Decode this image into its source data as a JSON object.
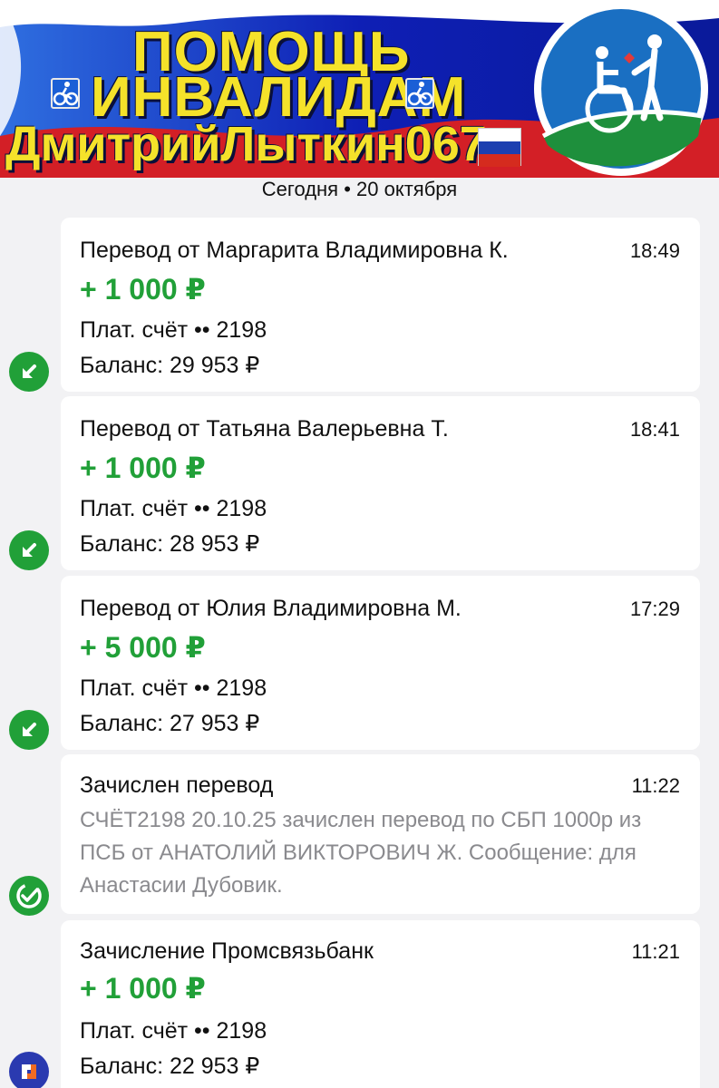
{
  "banner": {
    "line1": "ПОМОЩЬ",
    "line2": "ИНВАЛИДАМ",
    "line3": "ДмитрийЛыткин067",
    "left_icon": "cyclist-icon",
    "right_icon": "cyclist-icon",
    "flag": "russia-flag-icon",
    "emblem": "disability-care-emblem-icon"
  },
  "date_header": "Сегодня • 20 октября",
  "colors": {
    "income_green": "#21a038",
    "secondary_text": "#8a8a8e",
    "banner_blue": "#0f23b8",
    "banner_yellow": "#f5e22a"
  },
  "transactions": [
    {
      "title": "Перевод от Маргарита Владимировна К.",
      "time": "18:49",
      "amount": "+ 1 000 ₽",
      "account": "Плат. счёт •• 2198",
      "balance": "Баланс: 29 953 ₽",
      "icon": "incoming-arrow-icon"
    },
    {
      "title": "Перевод от Татьяна Валерьевна Т.",
      "time": "18:41",
      "amount": "+ 1 000 ₽",
      "account": "Плат. счёт •• 2198",
      "balance": "Баланс: 28 953 ₽",
      "icon": "incoming-arrow-icon"
    },
    {
      "title": "Перевод от Юлия Владимировна М.",
      "time": "17:29",
      "amount": "+ 5 000 ₽",
      "account": "Плат. счёт •• 2198",
      "balance": "Баланс: 27 953 ₽",
      "icon": "incoming-arrow-icon"
    },
    {
      "title": "Зачислен перевод",
      "time": "11:22",
      "message": "СЧЁТ2198 20.10.25 зачислен перевод по СБП 1000р из ПСБ от АНАТОЛИЙ ВИКТОРОВИЧ Ж. Сообщение: для Анастасии Дубовик.",
      "icon": "sber-check-icon"
    },
    {
      "title": "Зачисление Промсвязьбанк",
      "time": "11:21",
      "amount": "+ 1 000 ₽",
      "account": "Плат. счёт •• 2198",
      "balance": "Баланс: 22 953 ₽",
      "icon": "psb-bank-logo-icon"
    }
  ]
}
